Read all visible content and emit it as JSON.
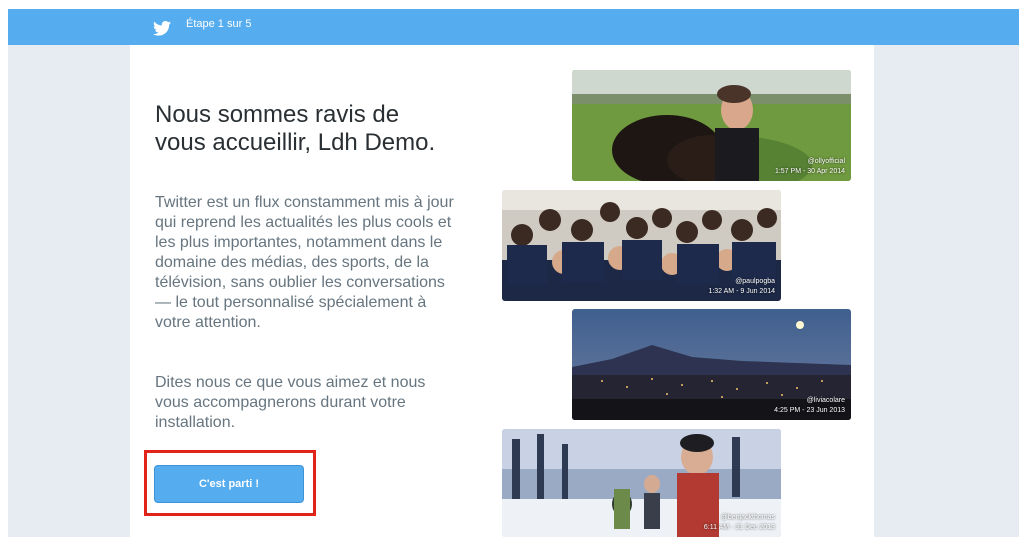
{
  "header": {
    "step_label": "Étape 1 sur 5",
    "brand_color": "#55acee",
    "logo_icon": "twitter-bird-icon"
  },
  "welcome": {
    "title": "Nous sommes ravis de vous accueillir, Ldh Demo.",
    "paragraph1": "Twitter est un flux constamment mis à jour qui reprend les actualités les plus cools et les plus importantes, notamment dans le domaine des médias, des sports, de la télévision, sans oublier les conversations — le tout personnalisé spécialement à votre attention.",
    "paragraph2": "Dites nous ce que vous aimez et nous vous accompagnerons durant votre installation.",
    "cta_label": "C'est parti !",
    "highlight_color": "#e2231a"
  },
  "photos": [
    {
      "handle": "@ollyofficial",
      "time": "1:57 PM - 30 Apr 2014"
    },
    {
      "handle": "@paulpogba",
      "time": "1:32 AM - 9 Jun 2014"
    },
    {
      "handle": "@liviacolare",
      "time": "4:25 PM - 23 Jun 2013"
    },
    {
      "handle": "@benjackthomas",
      "time": "6:11 AM - 31 Dec 2013"
    }
  ]
}
